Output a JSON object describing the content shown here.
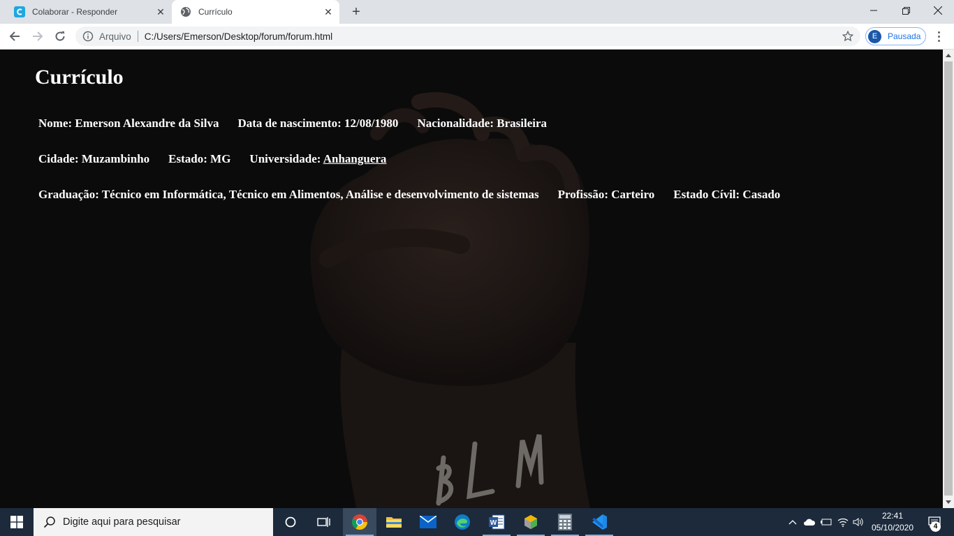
{
  "browser": {
    "tabs": [
      {
        "title": "Colaborar - Responder",
        "active": false,
        "favicon": "colaborar-icon"
      },
      {
        "title": "Currículo",
        "active": true,
        "favicon": "globe-icon"
      }
    ],
    "address": {
      "scheme_label": "Arquivo",
      "url": "C:/Users/Emerson/Desktop/forum/forum.html"
    },
    "profile": {
      "initial": "E",
      "status": "Pausada"
    }
  },
  "page": {
    "title": "Currículo",
    "rows": [
      [
        "Nome: Emerson Alexandre da Silva",
        "Data de nascimento: 12/08/1980",
        "Nacionalidade: Brasileira"
      ],
      [
        "Cidade: Muzambinho",
        "Estado: MG"
      ],
      [
        "Graduação: Técnico em Informática, Técnico em Alimentos, Análise e desenvolvimento de sistemas",
        "Profissão: Carteiro",
        "Estado Cívil: Casado"
      ]
    ],
    "universidade_label": "Universidade: ",
    "universidade_link": "Anhanguera",
    "background_text": "BLM"
  },
  "taskbar": {
    "search_placeholder": "Digite aqui para pesquisar",
    "time": "22:41",
    "date": "05/10/2020",
    "notifications": "4",
    "pinned": [
      "cortana-icon",
      "task-view-icon",
      "chrome-icon",
      "file-explorer-icon",
      "mail-icon",
      "edge-icon",
      "word-icon",
      "app-cube-icon",
      "calculator-icon",
      "vscode-icon"
    ]
  },
  "colors": {
    "page_bg": "#0b0b0b",
    "taskbar_bg": "#1c2a3c",
    "accent": "#1a73e8"
  }
}
